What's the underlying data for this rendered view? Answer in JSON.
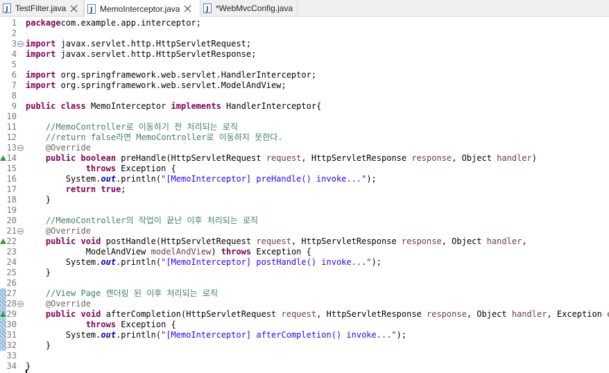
{
  "tabs": [
    {
      "label": "TestFilter.java",
      "active": false,
      "dirty": false
    },
    {
      "label": "MemoInterceptor.java",
      "active": true,
      "dirty": false
    },
    {
      "label": "*WebMvcConfig.java",
      "active": false,
      "dirty": true
    }
  ],
  "colors": {
    "keyword": "#7f0055",
    "comment": "#3f7f5f",
    "annotation": "#646464",
    "string": "#2a00ff",
    "parameter": "#6a3e3e",
    "static_field": "#0000c0",
    "line_number": "#787878"
  },
  "icons": {
    "tab_file": "java-file-icon",
    "tab_close": "close-icon",
    "fold": "fold-collapse-icon",
    "override": "override-marker-icon"
  },
  "lines": [
    {
      "n": "1",
      "tokens": [
        [
          "kw",
          "package"
        ],
        [
          "",
          "com.example.app.interceptor;"
        ]
      ]
    },
    {
      "n": "2",
      "tokens": []
    },
    {
      "n": "3",
      "fold": true,
      "tokens": [
        [
          "kw",
          "import"
        ],
        [
          "",
          " javax.servlet.http.HttpServletRequest;"
        ]
      ]
    },
    {
      "n": "4",
      "tokens": [
        [
          "kw",
          "import"
        ],
        [
          "",
          " javax.servlet.http.HttpServletResponse;"
        ]
      ]
    },
    {
      "n": "5",
      "tokens": []
    },
    {
      "n": "6",
      "tokens": [
        [
          "kw",
          "import"
        ],
        [
          "",
          " org.springframework.web.servlet.HandlerInterceptor;"
        ]
      ]
    },
    {
      "n": "7",
      "tokens": [
        [
          "kw",
          "import"
        ],
        [
          "",
          " org.springframework.web.servlet.ModelAndView;"
        ]
      ]
    },
    {
      "n": "8",
      "tokens": []
    },
    {
      "n": "9",
      "tokens": [
        [
          "kw",
          "public"
        ],
        [
          "",
          " "
        ],
        [
          "kw",
          "class"
        ],
        [
          "",
          " MemoInterceptor "
        ],
        [
          "kw",
          "implements"
        ],
        [
          "",
          " HandlerInterceptor{"
        ]
      ]
    },
    {
      "n": "10",
      "tokens": []
    },
    {
      "n": "11",
      "tokens": [
        [
          "",
          "    "
        ],
        [
          "cm",
          "//MemoController로 이동하기 전 처리되는 로직"
        ]
      ]
    },
    {
      "n": "12",
      "tokens": [
        [
          "",
          "    "
        ],
        [
          "cm",
          "//return false라면 MemoController로 이동하지 못한다."
        ]
      ]
    },
    {
      "n": "13",
      "fold": true,
      "tokens": [
        [
          "",
          "    "
        ],
        [
          "an",
          "@Override"
        ]
      ]
    },
    {
      "n": "14",
      "override": true,
      "tokens": [
        [
          "",
          "    "
        ],
        [
          "kw",
          "public"
        ],
        [
          "",
          " "
        ],
        [
          "kw",
          "boolean"
        ],
        [
          "",
          " preHandle(HttpServletRequest "
        ],
        [
          "pm",
          "request"
        ],
        [
          "",
          ", HttpServletResponse "
        ],
        [
          "pm",
          "response"
        ],
        [
          "",
          ", Object "
        ],
        [
          "pm",
          "handler"
        ],
        [
          "",
          ")"
        ]
      ]
    },
    {
      "n": "15",
      "tokens": [
        [
          "",
          "            "
        ],
        [
          "kw",
          "throws"
        ],
        [
          "",
          " Exception {"
        ]
      ]
    },
    {
      "n": "16",
      "tokens": [
        [
          "",
          "        System."
        ],
        [
          "sf",
          "out"
        ],
        [
          "",
          ".println("
        ],
        [
          "st",
          "\"[MemoInterceptor] preHandle() invoke...\""
        ],
        [
          "",
          ");"
        ]
      ]
    },
    {
      "n": "17",
      "tokens": [
        [
          "",
          "        "
        ],
        [
          "kw",
          "return"
        ],
        [
          "",
          " "
        ],
        [
          "kw",
          "true"
        ],
        [
          "",
          ";"
        ]
      ]
    },
    {
      "n": "18",
      "tokens": [
        [
          "",
          "    }"
        ]
      ]
    },
    {
      "n": "19",
      "tokens": []
    },
    {
      "n": "20",
      "tokens": [
        [
          "",
          "    "
        ],
        [
          "cm",
          "//MemoController의 작업이 끝난 이후 처리되는 로직"
        ]
      ]
    },
    {
      "n": "21",
      "fold": true,
      "tokens": [
        [
          "",
          "    "
        ],
        [
          "an",
          "@Override"
        ]
      ]
    },
    {
      "n": "22",
      "override": true,
      "tokens": [
        [
          "",
          "    "
        ],
        [
          "kw",
          "public"
        ],
        [
          "",
          " "
        ],
        [
          "kw",
          "void"
        ],
        [
          "",
          " postHandle(HttpServletRequest "
        ],
        [
          "pm",
          "request"
        ],
        [
          "",
          ", HttpServletResponse "
        ],
        [
          "pm",
          "response"
        ],
        [
          "",
          ", Object "
        ],
        [
          "pm",
          "handler"
        ],
        [
          "",
          ","
        ]
      ]
    },
    {
      "n": "23",
      "tokens": [
        [
          "",
          "            ModelAndView "
        ],
        [
          "pm",
          "modelAndView"
        ],
        [
          "",
          ") "
        ],
        [
          "kw",
          "throws"
        ],
        [
          "",
          " Exception {"
        ]
      ]
    },
    {
      "n": "24",
      "tokens": [
        [
          "",
          "        System."
        ],
        [
          "sf",
          "out"
        ],
        [
          "",
          ".println("
        ],
        [
          "st",
          "\"[MemoInterceptor] postHandle() invoke...\""
        ],
        [
          "",
          ");"
        ]
      ]
    },
    {
      "n": "25",
      "tokens": [
        [
          "",
          "    }"
        ]
      ]
    },
    {
      "n": "26",
      "tokens": []
    },
    {
      "n": "27",
      "changed": true,
      "tokens": [
        [
          "",
          "    "
        ],
        [
          "cm",
          "//View Page 랜더링 된 이후 처리되는 로직"
        ]
      ]
    },
    {
      "n": "28",
      "changed": true,
      "fold": true,
      "tokens": [
        [
          "",
          "    "
        ],
        [
          "an",
          "@Override"
        ]
      ]
    },
    {
      "n": "29",
      "changed": true,
      "override": true,
      "tokens": [
        [
          "",
          "    "
        ],
        [
          "kw",
          "public"
        ],
        [
          "",
          " "
        ],
        [
          "kw",
          "void"
        ],
        [
          "",
          " afterCompletion(HttpServletRequest "
        ],
        [
          "pm",
          "request"
        ],
        [
          "",
          ", HttpServletResponse "
        ],
        [
          "pm",
          "response"
        ],
        [
          "",
          ", Object "
        ],
        [
          "pm",
          "handler"
        ],
        [
          "",
          ", Exception "
        ],
        [
          "pm",
          "ex"
        ],
        [
          "",
          ")"
        ]
      ]
    },
    {
      "n": "30",
      "changed": true,
      "tokens": [
        [
          "",
          "            "
        ],
        [
          "kw",
          "throws"
        ],
        [
          "",
          " Exception {"
        ]
      ]
    },
    {
      "n": "31",
      "changed": true,
      "tokens": [
        [
          "",
          "        System."
        ],
        [
          "sf",
          "out"
        ],
        [
          "",
          ".println("
        ],
        [
          "st",
          "\"[MemoInterceptor] afterCompletion() invoke...\""
        ],
        [
          "",
          ");"
        ]
      ]
    },
    {
      "n": "32",
      "changed": true,
      "tokens": [
        [
          "",
          "    }"
        ]
      ]
    },
    {
      "n": "33",
      "tokens": []
    },
    {
      "n": "34",
      "tokens": [
        [
          "",
          "}"
        ]
      ]
    }
  ]
}
